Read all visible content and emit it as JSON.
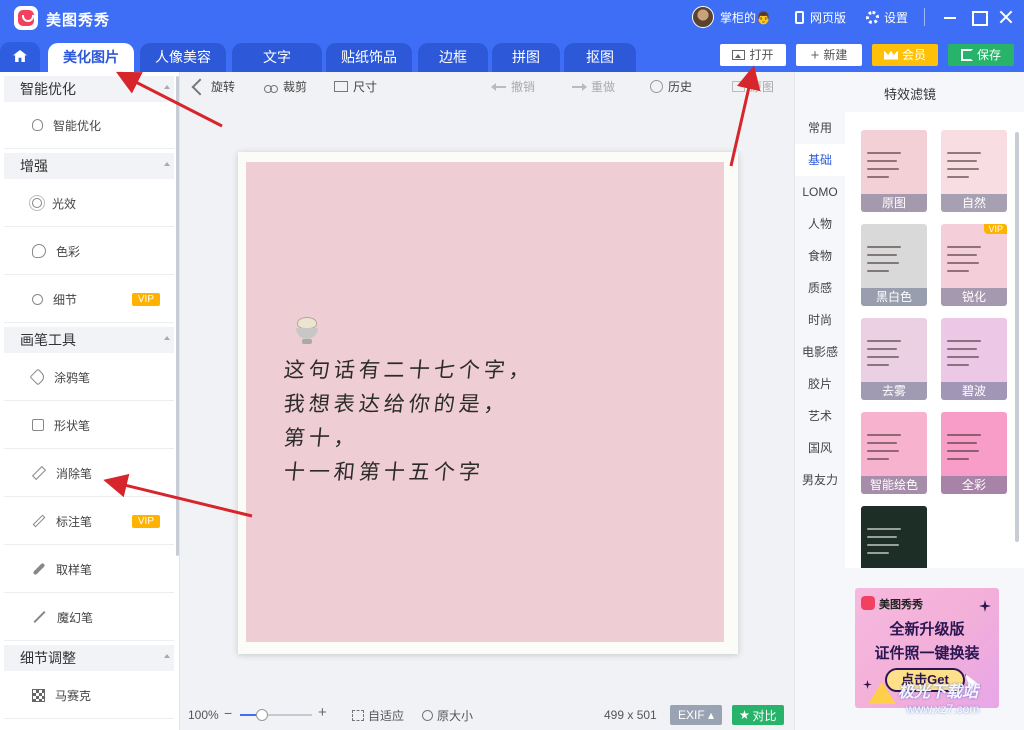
{
  "app": {
    "name": "美图秀秀"
  },
  "titlebar": {
    "user": "掌柜的👨",
    "web_version": "网页版",
    "settings": "设置"
  },
  "tabs": [
    {
      "label": "美化图片",
      "active": true
    },
    {
      "label": "人像美容"
    },
    {
      "label": "文字"
    },
    {
      "label": "贴纸饰品"
    },
    {
      "label": "边框"
    },
    {
      "label": "拼图"
    },
    {
      "label": "抠图"
    }
  ],
  "actions": {
    "open": "打开",
    "new": "新建",
    "vip": "会员",
    "save": "保存"
  },
  "sidebar": {
    "sections": [
      {
        "title": "智能优化",
        "items": [
          {
            "label": "智能优化",
            "icon": "bulb-icon"
          }
        ]
      },
      {
        "title": "增强",
        "items": [
          {
            "label": "光效",
            "icon": "sun-icon"
          },
          {
            "label": "色彩",
            "icon": "palette-icon"
          },
          {
            "label": "细节",
            "icon": "magnify-icon",
            "vip": "VIP"
          }
        ]
      },
      {
        "title": "画笔工具",
        "items": [
          {
            "label": "涂鸦笔",
            "icon": "brush-icon"
          },
          {
            "label": "形状笔",
            "icon": "shape-icon"
          },
          {
            "label": "消除笔",
            "icon": "eraser-icon"
          },
          {
            "label": "标注笔",
            "icon": "pen-icon",
            "vip": "VIP"
          },
          {
            "label": "取样笔",
            "icon": "dropper-icon"
          },
          {
            "label": "魔幻笔",
            "icon": "wand-icon"
          }
        ]
      },
      {
        "title": "细节调整",
        "items": [
          {
            "label": "马赛克",
            "icon": "mosaic-icon"
          }
        ]
      }
    ]
  },
  "editbar": {
    "rotate": "旋转",
    "crop": "裁剪",
    "size": "尺寸",
    "undo": "撤销",
    "redo": "重做",
    "history": "历史",
    "original": "原图"
  },
  "photo": {
    "lines": [
      "这句话有二十七个字，",
      "我想表达给你的是，",
      "第十，",
      "十一和第十五个字"
    ]
  },
  "statusbar": {
    "zoom": "100%",
    "zoom_level": 0.3,
    "fit": "自适应",
    "actual": "原大小",
    "dims": "499 x 501",
    "exif": "EXIF ▴",
    "compare": "对比"
  },
  "right_panel": {
    "title": "特效滤镜",
    "categories": [
      "常用",
      "基础",
      "LOMO",
      "人物",
      "食物",
      "质感",
      "时尚",
      "电影感",
      "胶片",
      "艺术",
      "国风",
      "男友力"
    ],
    "active_category": "基础",
    "filters": [
      {
        "label": "原图",
        "color": "#f3cfd6"
      },
      {
        "label": "自然",
        "color": "#f8dde3"
      },
      {
        "label": "黑白色",
        "color": "#d9d9d9"
      },
      {
        "label": "锐化",
        "color": "#f4cfd9",
        "vip": "VIP"
      },
      {
        "label": "去雾",
        "color": "#ead0e2"
      },
      {
        "label": "碧波",
        "color": "#ecc8e6"
      },
      {
        "label": "智能绘色",
        "color": "#f7b3cd"
      },
      {
        "label": "全彩",
        "color": "#f89dc8"
      },
      {
        "label": "",
        "color": "#1d2e27"
      }
    ]
  },
  "ad": {
    "brand": "美图秀秀",
    "line1": "全新升级版",
    "line2": "证件照一键换装",
    "button": "点击Get"
  },
  "watermark": {
    "text": "极光下载站",
    "url": "www.xz7.com"
  }
}
